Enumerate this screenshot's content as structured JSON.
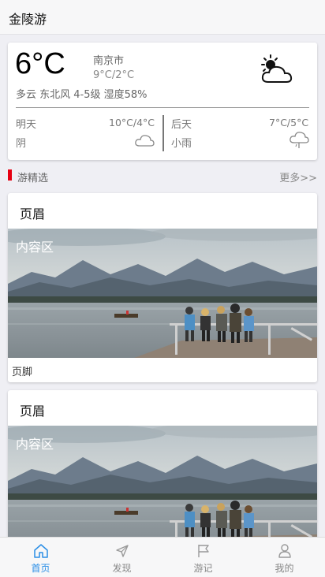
{
  "app": {
    "title": "金陵游"
  },
  "weather": {
    "temp": "6°C",
    "city": "南京市",
    "range": "9°C/2°C",
    "desc": "多云 东北风 4-5级 湿度58%",
    "icon": "partly-cloudy-icon",
    "forecast": [
      {
        "day": "明天",
        "range": "10°C/4°C",
        "cond": "阴",
        "icon": "cloud-icon"
      },
      {
        "day": "后天",
        "range": "7°C/5°C",
        "cond": "小雨",
        "icon": "rain-cloud-icon"
      }
    ]
  },
  "section": {
    "label": "游精选",
    "more": "更多>>"
  },
  "cards": [
    {
      "header": "页眉",
      "content": "内容区",
      "footer": "页脚"
    },
    {
      "header": "页眉",
      "content": "内容区",
      "footer": ""
    }
  ],
  "tabbar": {
    "active": "home",
    "active_color": "#2a8ee6",
    "items": [
      {
        "label": "首页",
        "icon": "home-icon"
      },
      {
        "label": "发现",
        "icon": "discover-icon"
      },
      {
        "label": "游记",
        "icon": "flag-icon"
      },
      {
        "label": "我的",
        "icon": "user-icon"
      }
    ]
  }
}
